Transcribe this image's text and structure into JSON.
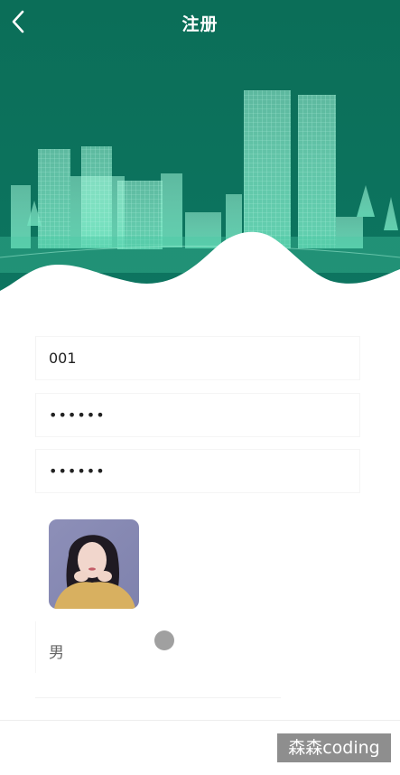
{
  "header": {
    "title": "注册"
  },
  "form": {
    "username_value": "001",
    "password_value": "••••••",
    "confirm_password_value": "••••••",
    "gender_value": "男"
  },
  "watermark": {
    "text": "森森coding"
  },
  "colors": {
    "brand_green": "#0b6e58",
    "skyline": "#7ee8c6"
  }
}
